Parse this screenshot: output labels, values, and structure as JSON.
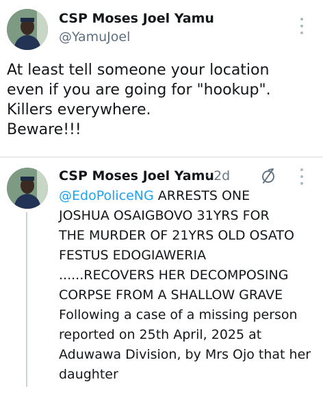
{
  "main_tweet": {
    "author_name": "CSP Moses Joel Yamu",
    "handle": "@YamuJoel",
    "text_lines": [
      "At least tell someone your location",
      "even if you are going for \"hookup\".",
      "Killers everywhere.",
      "Beware!!!"
    ]
  },
  "quoted_tweet": {
    "author_name": "CSP Moses Joel Yamu",
    "time": "· 2d",
    "mention": "@EdoPoliceNG",
    "first_line_rest": " ARRESTS ONE",
    "text_lines": [
      "JOSHUA OSAIGBOVO 31YRS FOR",
      "THE MURDER OF 21YRS OLD OSATO",
      "FESTUS EDOGIAWERIA",
      "......RECOVERS HER DECOMPOSING",
      "CORPSE FROM A SHALLOW GRAVE",
      "Following a case of a missing person",
      "reported on 25th April, 2025 at",
      "Aduwawa Division, by Mrs Ojo that her",
      "daughter"
    ]
  },
  "icons": {
    "more": "more-vertical-icon",
    "retweet": "retweet-icon",
    "avatar": "avatar"
  },
  "colors": {
    "link": "#1da1f2",
    "secondary_text": "#5b7083",
    "thread_line": "#c9d2d9"
  }
}
